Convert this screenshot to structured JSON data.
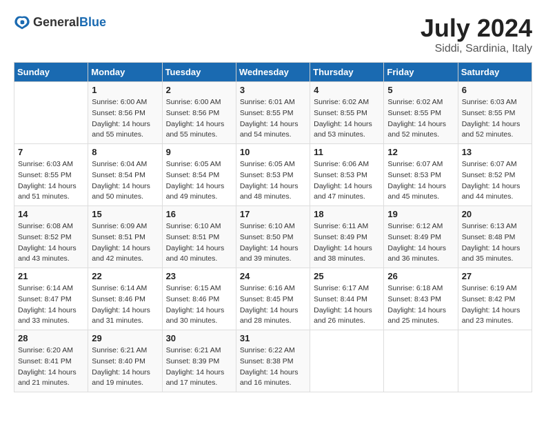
{
  "header": {
    "logo": {
      "text_general": "General",
      "text_blue": "Blue"
    },
    "title": "July 2024",
    "subtitle": "Siddi, Sardinia, Italy"
  },
  "calendar": {
    "days_of_week": [
      "Sunday",
      "Monday",
      "Tuesday",
      "Wednesday",
      "Thursday",
      "Friday",
      "Saturday"
    ],
    "weeks": [
      [
        {
          "day": "",
          "info": ""
        },
        {
          "day": "1",
          "info": "Sunrise: 6:00 AM\nSunset: 8:56 PM\nDaylight: 14 hours\nand 55 minutes."
        },
        {
          "day": "2",
          "info": "Sunrise: 6:00 AM\nSunset: 8:56 PM\nDaylight: 14 hours\nand 55 minutes."
        },
        {
          "day": "3",
          "info": "Sunrise: 6:01 AM\nSunset: 8:55 PM\nDaylight: 14 hours\nand 54 minutes."
        },
        {
          "day": "4",
          "info": "Sunrise: 6:02 AM\nSunset: 8:55 PM\nDaylight: 14 hours\nand 53 minutes."
        },
        {
          "day": "5",
          "info": "Sunrise: 6:02 AM\nSunset: 8:55 PM\nDaylight: 14 hours\nand 52 minutes."
        },
        {
          "day": "6",
          "info": "Sunrise: 6:03 AM\nSunset: 8:55 PM\nDaylight: 14 hours\nand 52 minutes."
        }
      ],
      [
        {
          "day": "7",
          "info": "Sunrise: 6:03 AM\nSunset: 8:55 PM\nDaylight: 14 hours\nand 51 minutes."
        },
        {
          "day": "8",
          "info": "Sunrise: 6:04 AM\nSunset: 8:54 PM\nDaylight: 14 hours\nand 50 minutes."
        },
        {
          "day": "9",
          "info": "Sunrise: 6:05 AM\nSunset: 8:54 PM\nDaylight: 14 hours\nand 49 minutes."
        },
        {
          "day": "10",
          "info": "Sunrise: 6:05 AM\nSunset: 8:53 PM\nDaylight: 14 hours\nand 48 minutes."
        },
        {
          "day": "11",
          "info": "Sunrise: 6:06 AM\nSunset: 8:53 PM\nDaylight: 14 hours\nand 47 minutes."
        },
        {
          "day": "12",
          "info": "Sunrise: 6:07 AM\nSunset: 8:53 PM\nDaylight: 14 hours\nand 45 minutes."
        },
        {
          "day": "13",
          "info": "Sunrise: 6:07 AM\nSunset: 8:52 PM\nDaylight: 14 hours\nand 44 minutes."
        }
      ],
      [
        {
          "day": "14",
          "info": "Sunrise: 6:08 AM\nSunset: 8:52 PM\nDaylight: 14 hours\nand 43 minutes."
        },
        {
          "day": "15",
          "info": "Sunrise: 6:09 AM\nSunset: 8:51 PM\nDaylight: 14 hours\nand 42 minutes."
        },
        {
          "day": "16",
          "info": "Sunrise: 6:10 AM\nSunset: 8:51 PM\nDaylight: 14 hours\nand 40 minutes."
        },
        {
          "day": "17",
          "info": "Sunrise: 6:10 AM\nSunset: 8:50 PM\nDaylight: 14 hours\nand 39 minutes."
        },
        {
          "day": "18",
          "info": "Sunrise: 6:11 AM\nSunset: 8:49 PM\nDaylight: 14 hours\nand 38 minutes."
        },
        {
          "day": "19",
          "info": "Sunrise: 6:12 AM\nSunset: 8:49 PM\nDaylight: 14 hours\nand 36 minutes."
        },
        {
          "day": "20",
          "info": "Sunrise: 6:13 AM\nSunset: 8:48 PM\nDaylight: 14 hours\nand 35 minutes."
        }
      ],
      [
        {
          "day": "21",
          "info": "Sunrise: 6:14 AM\nSunset: 8:47 PM\nDaylight: 14 hours\nand 33 minutes."
        },
        {
          "day": "22",
          "info": "Sunrise: 6:14 AM\nSunset: 8:46 PM\nDaylight: 14 hours\nand 31 minutes."
        },
        {
          "day": "23",
          "info": "Sunrise: 6:15 AM\nSunset: 8:46 PM\nDaylight: 14 hours\nand 30 minutes."
        },
        {
          "day": "24",
          "info": "Sunrise: 6:16 AM\nSunset: 8:45 PM\nDaylight: 14 hours\nand 28 minutes."
        },
        {
          "day": "25",
          "info": "Sunrise: 6:17 AM\nSunset: 8:44 PM\nDaylight: 14 hours\nand 26 minutes."
        },
        {
          "day": "26",
          "info": "Sunrise: 6:18 AM\nSunset: 8:43 PM\nDaylight: 14 hours\nand 25 minutes."
        },
        {
          "day": "27",
          "info": "Sunrise: 6:19 AM\nSunset: 8:42 PM\nDaylight: 14 hours\nand 23 minutes."
        }
      ],
      [
        {
          "day": "28",
          "info": "Sunrise: 6:20 AM\nSunset: 8:41 PM\nDaylight: 14 hours\nand 21 minutes."
        },
        {
          "day": "29",
          "info": "Sunrise: 6:21 AM\nSunset: 8:40 PM\nDaylight: 14 hours\nand 19 minutes."
        },
        {
          "day": "30",
          "info": "Sunrise: 6:21 AM\nSunset: 8:39 PM\nDaylight: 14 hours\nand 17 minutes."
        },
        {
          "day": "31",
          "info": "Sunrise: 6:22 AM\nSunset: 8:38 PM\nDaylight: 14 hours\nand 16 minutes."
        },
        {
          "day": "",
          "info": ""
        },
        {
          "day": "",
          "info": ""
        },
        {
          "day": "",
          "info": ""
        }
      ]
    ]
  }
}
